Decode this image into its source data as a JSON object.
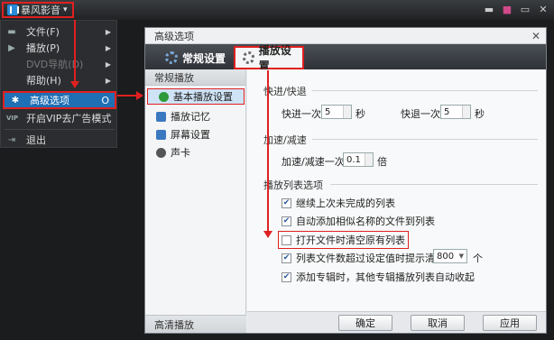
{
  "app": {
    "title": "暴风影音",
    "title_caret": "▾"
  },
  "window_controls": {
    "minimize": "▬",
    "skin": "■",
    "mini": "▭",
    "close": "✕"
  },
  "menu": {
    "items": [
      {
        "label": "文件(F)",
        "icon": "folder-icon"
      },
      {
        "label": "播放(P)",
        "icon": "play-icon"
      },
      {
        "label": "DVD导航(D)"
      },
      {
        "label": "帮助(H)"
      },
      {
        "label": "高级选项",
        "shortcut": "O",
        "icon": "gear-icon"
      },
      {
        "label": "开启VIP去广告模式",
        "icon": "vip-icon",
        "icon_text": "VIP"
      },
      {
        "label": "退出",
        "icon": "exit-icon"
      }
    ],
    "submenu_arrow": "▶"
  },
  "dialog": {
    "title": "高级选项",
    "close": "✕",
    "tabs": [
      {
        "label": "常规设置"
      },
      {
        "label": "播放设置"
      }
    ],
    "left_header": "常规播放",
    "left_items": [
      {
        "label": "基本播放设置",
        "icon_color": "#2e9a3a"
      },
      {
        "label": "播放记忆",
        "icon_color": "#3a78c0"
      },
      {
        "label": "屏幕设置",
        "icon_color": "#3a78c0"
      },
      {
        "label": "声卡",
        "icon_color": "#555555"
      }
    ],
    "left_footer": "高清播放",
    "sections": {
      "seek": {
        "title": "快进/快退",
        "forward_label": "快进一次",
        "forward_value": "5",
        "forward_unit": "秒",
        "back_label": "快退一次",
        "back_value": "5",
        "back_unit": "秒"
      },
      "speed": {
        "title": "加速/减速",
        "label": "加速/减速一次",
        "value": "0.1",
        "unit": "倍"
      },
      "playlist": {
        "title": "播放列表选项",
        "options": [
          {
            "label": "继续上次未完成的列表",
            "checked": true
          },
          {
            "label": "自动添加相似名称的文件到列表",
            "checked": true
          },
          {
            "label": "打开文件时清空原有列表",
            "checked": false
          },
          {
            "label": "列表文件数超过设定值时提示清理",
            "checked": true
          },
          {
            "label": "添加专辑时，其他专辑播放列表自动收起",
            "checked": true
          }
        ],
        "limit_value": "800",
        "limit_unit": "个"
      }
    },
    "buttons": {
      "ok": "确定",
      "cancel": "取消",
      "apply": "应用"
    }
  },
  "colors": {
    "accent": "#1f6fb5",
    "highlight_box": "#e02020"
  }
}
